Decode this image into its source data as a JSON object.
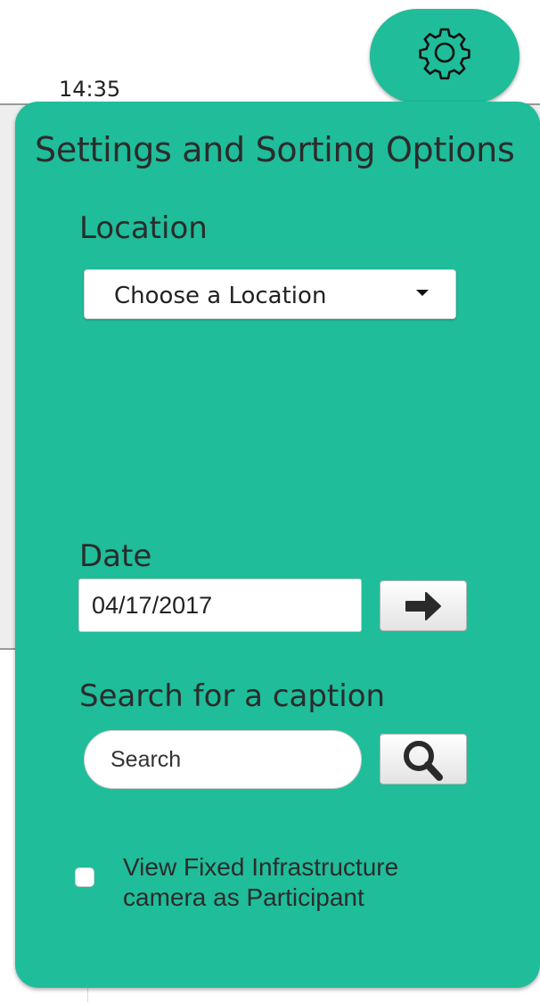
{
  "status": {
    "time": "14:35"
  },
  "settings_button": {
    "icon": "gear-icon"
  },
  "panel": {
    "title": "Settings and Sorting Options",
    "location": {
      "label": "Location",
      "selected": "Choose a Location"
    },
    "date": {
      "label": "Date",
      "value": "04/17/2017",
      "submit_icon": "arrow-right-icon"
    },
    "caption_search": {
      "label": "Search for a caption",
      "placeholder": "Search",
      "submit_icon": "search-icon"
    },
    "fixed_camera_option": {
      "label": "View Fixed Infrastructure camera as Participant",
      "checked": false
    }
  },
  "colors": {
    "accent": "#1fbd9a",
    "text": "#2b2b2b"
  }
}
